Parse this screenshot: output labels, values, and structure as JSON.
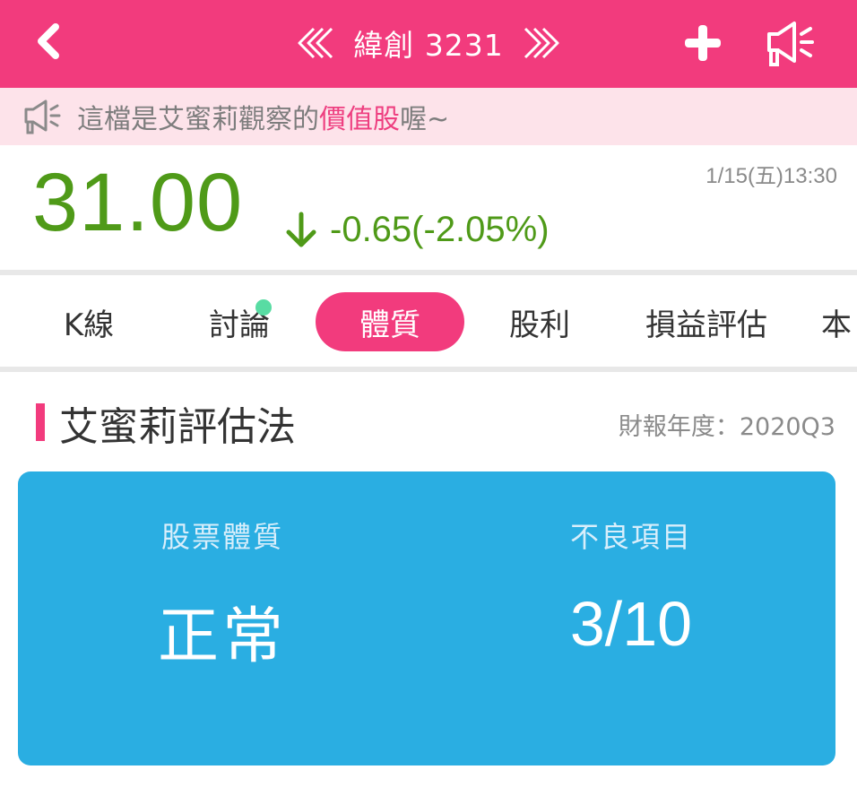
{
  "header": {
    "title": "緯創 3231",
    "back_icon": "back-chevron-icon",
    "prev_icon": "double-chevron-left-icon",
    "next_icon": "double-chevron-right-icon",
    "add_icon": "plus-icon",
    "share_icon": "megaphone-icon"
  },
  "notice": {
    "icon": "megaphone-icon",
    "prefix": "這檔是艾蜜莉觀察的",
    "highlight": "價值股",
    "suffix": "喔~"
  },
  "quote": {
    "price": "31.00",
    "change": "-0.65(-2.05%)",
    "direction": "down",
    "timestamp": "1/15(五)13:30",
    "color": "#4f9a18"
  },
  "tabs": [
    {
      "label": "K線",
      "active": false
    },
    {
      "label": "討論",
      "active": false,
      "has_new": true
    },
    {
      "label": "體質",
      "active": true
    },
    {
      "label": "股利",
      "active": false
    },
    {
      "label": "損益評估",
      "active": false
    },
    {
      "label": "本",
      "active": false
    }
  ],
  "section": {
    "title": "艾蜜莉評估法",
    "report_label": "財報年度：2020Q3"
  },
  "card": {
    "quality_label": "股票體質",
    "quality_value": "正常",
    "bad_items_label": "不良項目",
    "bad_items_value": "3/10",
    "color": "#2aaee2"
  },
  "colors": {
    "brand": "#f23b7d",
    "notice_bg": "#fde3ea",
    "new_dot": "#58dca3"
  }
}
